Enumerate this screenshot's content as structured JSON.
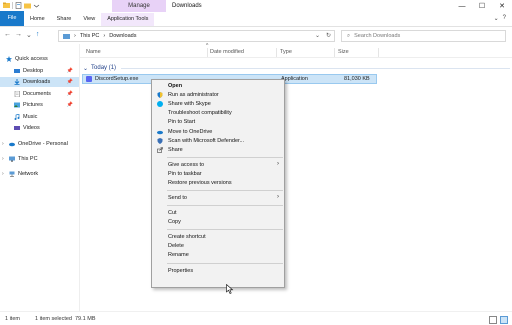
{
  "window": {
    "manage_tab": "Manage",
    "title": "Downloads",
    "minimize": "—",
    "maximize": "☐",
    "close": "✕"
  },
  "ribbon": {
    "tabs": [
      "File",
      "Home",
      "Share",
      "View",
      "Application Tools"
    ],
    "collapse": "⌄",
    "help": "?"
  },
  "address": {
    "back": "←",
    "forward": "→",
    "recent": "⌄",
    "up": "↑",
    "crumbs": [
      "This PC",
      "Downloads"
    ],
    "sep": "›",
    "dropdown": "⌄",
    "refresh": "↻",
    "search_placeholder": "Search Downloads",
    "search_icon": "⌕"
  },
  "nav": {
    "items": [
      {
        "label": "Quick access",
        "icon": "star-icon"
      },
      {
        "label": "Desktop",
        "icon": "desktop-icon"
      },
      {
        "label": "Downloads",
        "icon": "download-icon"
      },
      {
        "label": "Documents",
        "icon": "documents-icon"
      },
      {
        "label": "Pictures",
        "icon": "pictures-icon"
      },
      {
        "label": "Music",
        "icon": "music-icon"
      },
      {
        "label": "Videos",
        "icon": "videos-icon"
      },
      {
        "label": "OneDrive - Personal",
        "icon": "cloud-icon"
      },
      {
        "label": "This PC",
        "icon": "pc-icon"
      },
      {
        "label": "Network",
        "icon": "network-icon"
      }
    ],
    "pin": "📌",
    "expand": "›"
  },
  "columns": {
    "name": "Name",
    "date": "Date modified",
    "type": "Type",
    "size": "Size",
    "sort": "^"
  },
  "group": {
    "label": "Today (1)",
    "chevron": "⌄"
  },
  "file": {
    "name": "DiscordSetup.exe",
    "type": "Application",
    "size": "81,030 KB"
  },
  "context_menu": {
    "items": [
      {
        "label": "Open",
        "bold": true
      },
      {
        "label": "Run as administrator",
        "icon": "shield-icon"
      },
      {
        "label": "Share with Skype",
        "icon": "skype-icon"
      },
      {
        "label": "Troubleshoot compatibility"
      },
      {
        "label": "Pin to Start"
      },
      {
        "label": "Move to OneDrive",
        "icon": "onedrive-icon"
      },
      {
        "label": "Scan with Microsoft Defender...",
        "icon": "defender-icon"
      },
      {
        "label": "Share",
        "icon": "share-icon"
      },
      {
        "label": "Give access to",
        "submenu": true
      },
      {
        "label": "Pin to taskbar"
      },
      {
        "label": "Restore previous versions"
      },
      {
        "label": "Send to",
        "submenu": true
      },
      {
        "label": "Cut"
      },
      {
        "label": "Copy"
      },
      {
        "label": "Create shortcut"
      },
      {
        "label": "Delete"
      },
      {
        "label": "Rename"
      },
      {
        "label": "Properties"
      }
    ],
    "arrow": "›"
  },
  "status": {
    "count": "1 item",
    "selection": "1 item selected",
    "size": "79.1 MB"
  },
  "colors": {
    "accent": "#1979ca",
    "selection": "#cce4f7",
    "manage_tab": "#e8d2f7"
  }
}
